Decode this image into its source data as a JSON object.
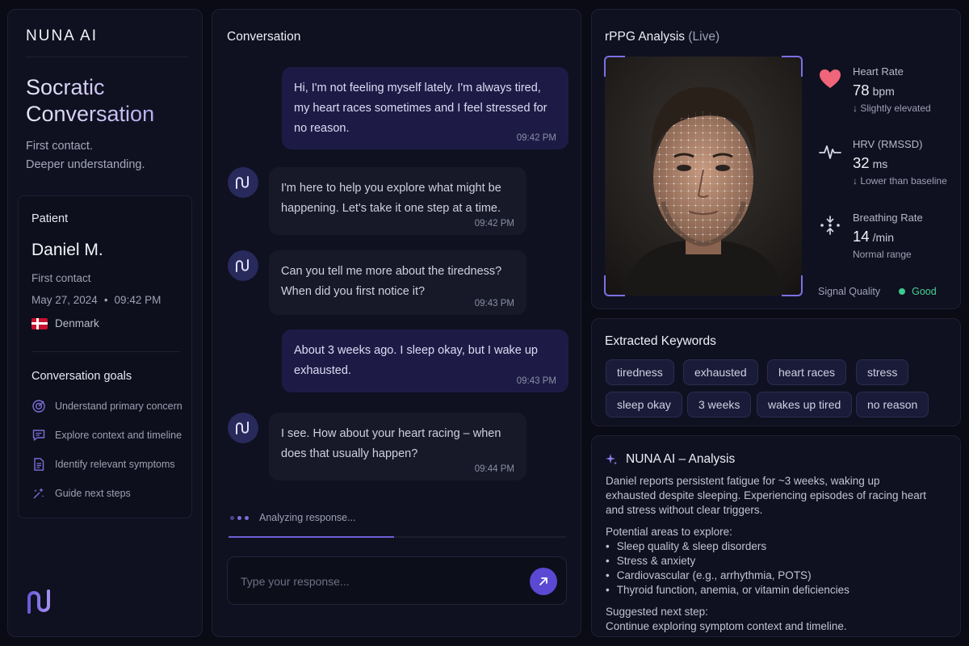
{
  "brand": "NUNA AI",
  "hero": {
    "title": "Socratic Conversation",
    "sub1": "First contact.",
    "sub2": "Deeper understanding."
  },
  "patient": {
    "label": "Patient",
    "name": "Daniel M.",
    "contact": "First contact",
    "date": "May 27, 2024",
    "dot": "•",
    "time": "09:42 PM",
    "country": "Denmark"
  },
  "goals": {
    "title": "Conversation goals",
    "items": [
      {
        "label": "Understand primary concern",
        "icon": "target-icon"
      },
      {
        "label": "Explore context and timeline",
        "icon": "chat-icon"
      },
      {
        "label": "Identify relevant symptoms",
        "icon": "document-icon"
      },
      {
        "label": "Guide next steps",
        "icon": "sparkle-icon"
      }
    ]
  },
  "conversation": {
    "title": "Conversation",
    "messages": [
      {
        "role": "user",
        "text": "Hi, I'm not feeling myself lately. I'm always tired, my heart races sometimes and I feel stressed for no reason.",
        "time": "09:42 PM"
      },
      {
        "role": "ai",
        "text": "I'm here to help you explore what might be happening. Let's take it one step at a time.",
        "time": "09:42 PM"
      },
      {
        "role": "ai",
        "text": "Can you tell me more about the tiredness? When did you first notice it?",
        "time": "09:43 PM"
      },
      {
        "role": "user",
        "text": "About 3 weeks ago. I sleep okay, but I wake up exhausted.",
        "time": "09:43 PM"
      },
      {
        "role": "ai",
        "text": "I see. How about your heart racing – when does that usually happen?",
        "time": "09:44 PM"
      }
    ],
    "status": "Analyzing response...",
    "progress": 0.49,
    "input_placeholder": "Type your response..."
  },
  "rppg": {
    "title": "rPPG Analysis",
    "live": "(Live)",
    "metrics": [
      {
        "label": "Heart Rate",
        "value": "78",
        "unit": "bpm",
        "note": "↓ Slightly elevated",
        "icon": "heart-icon"
      },
      {
        "label": "HRV (RMSSD)",
        "value": "32",
        "unit": "ms",
        "note": "↓ Lower than baseline",
        "icon": "pulse-icon"
      },
      {
        "label": "Breathing Rate",
        "value": "14",
        "unit": "/min",
        "note": "Normal range",
        "icon": "breathing-icon"
      }
    ],
    "signal_label": "Signal Quality",
    "signal_value": "Good"
  },
  "keywords": {
    "title": "Extracted Keywords",
    "items": [
      "tiredness",
      "exhausted",
      "heart races",
      "stress",
      "sleep okay",
      "3 weeks",
      "wakes up tired",
      "no reason"
    ]
  },
  "analysis": {
    "title": "NUNA AI – Analysis",
    "summary": "Daniel reports persistent fatigue for ~3 weeks, waking up exhausted despite sleeping. Experiencing episodes of racing heart and stress without clear triggers.",
    "areas_title": "Potential areas to explore:",
    "areas": [
      "Sleep quality & sleep disorders",
      "Stress & anxiety",
      "Cardiovascular (e.g., arrhythmia, POTS)",
      "Thyroid function, anemia, or vitamin deficiencies"
    ],
    "next_title": "Suggested next step:",
    "next": "Continue exploring symptom context and timeline."
  },
  "colors": {
    "accent": "#5b48d3",
    "good": "#47d193",
    "heart": "#f0657a"
  }
}
